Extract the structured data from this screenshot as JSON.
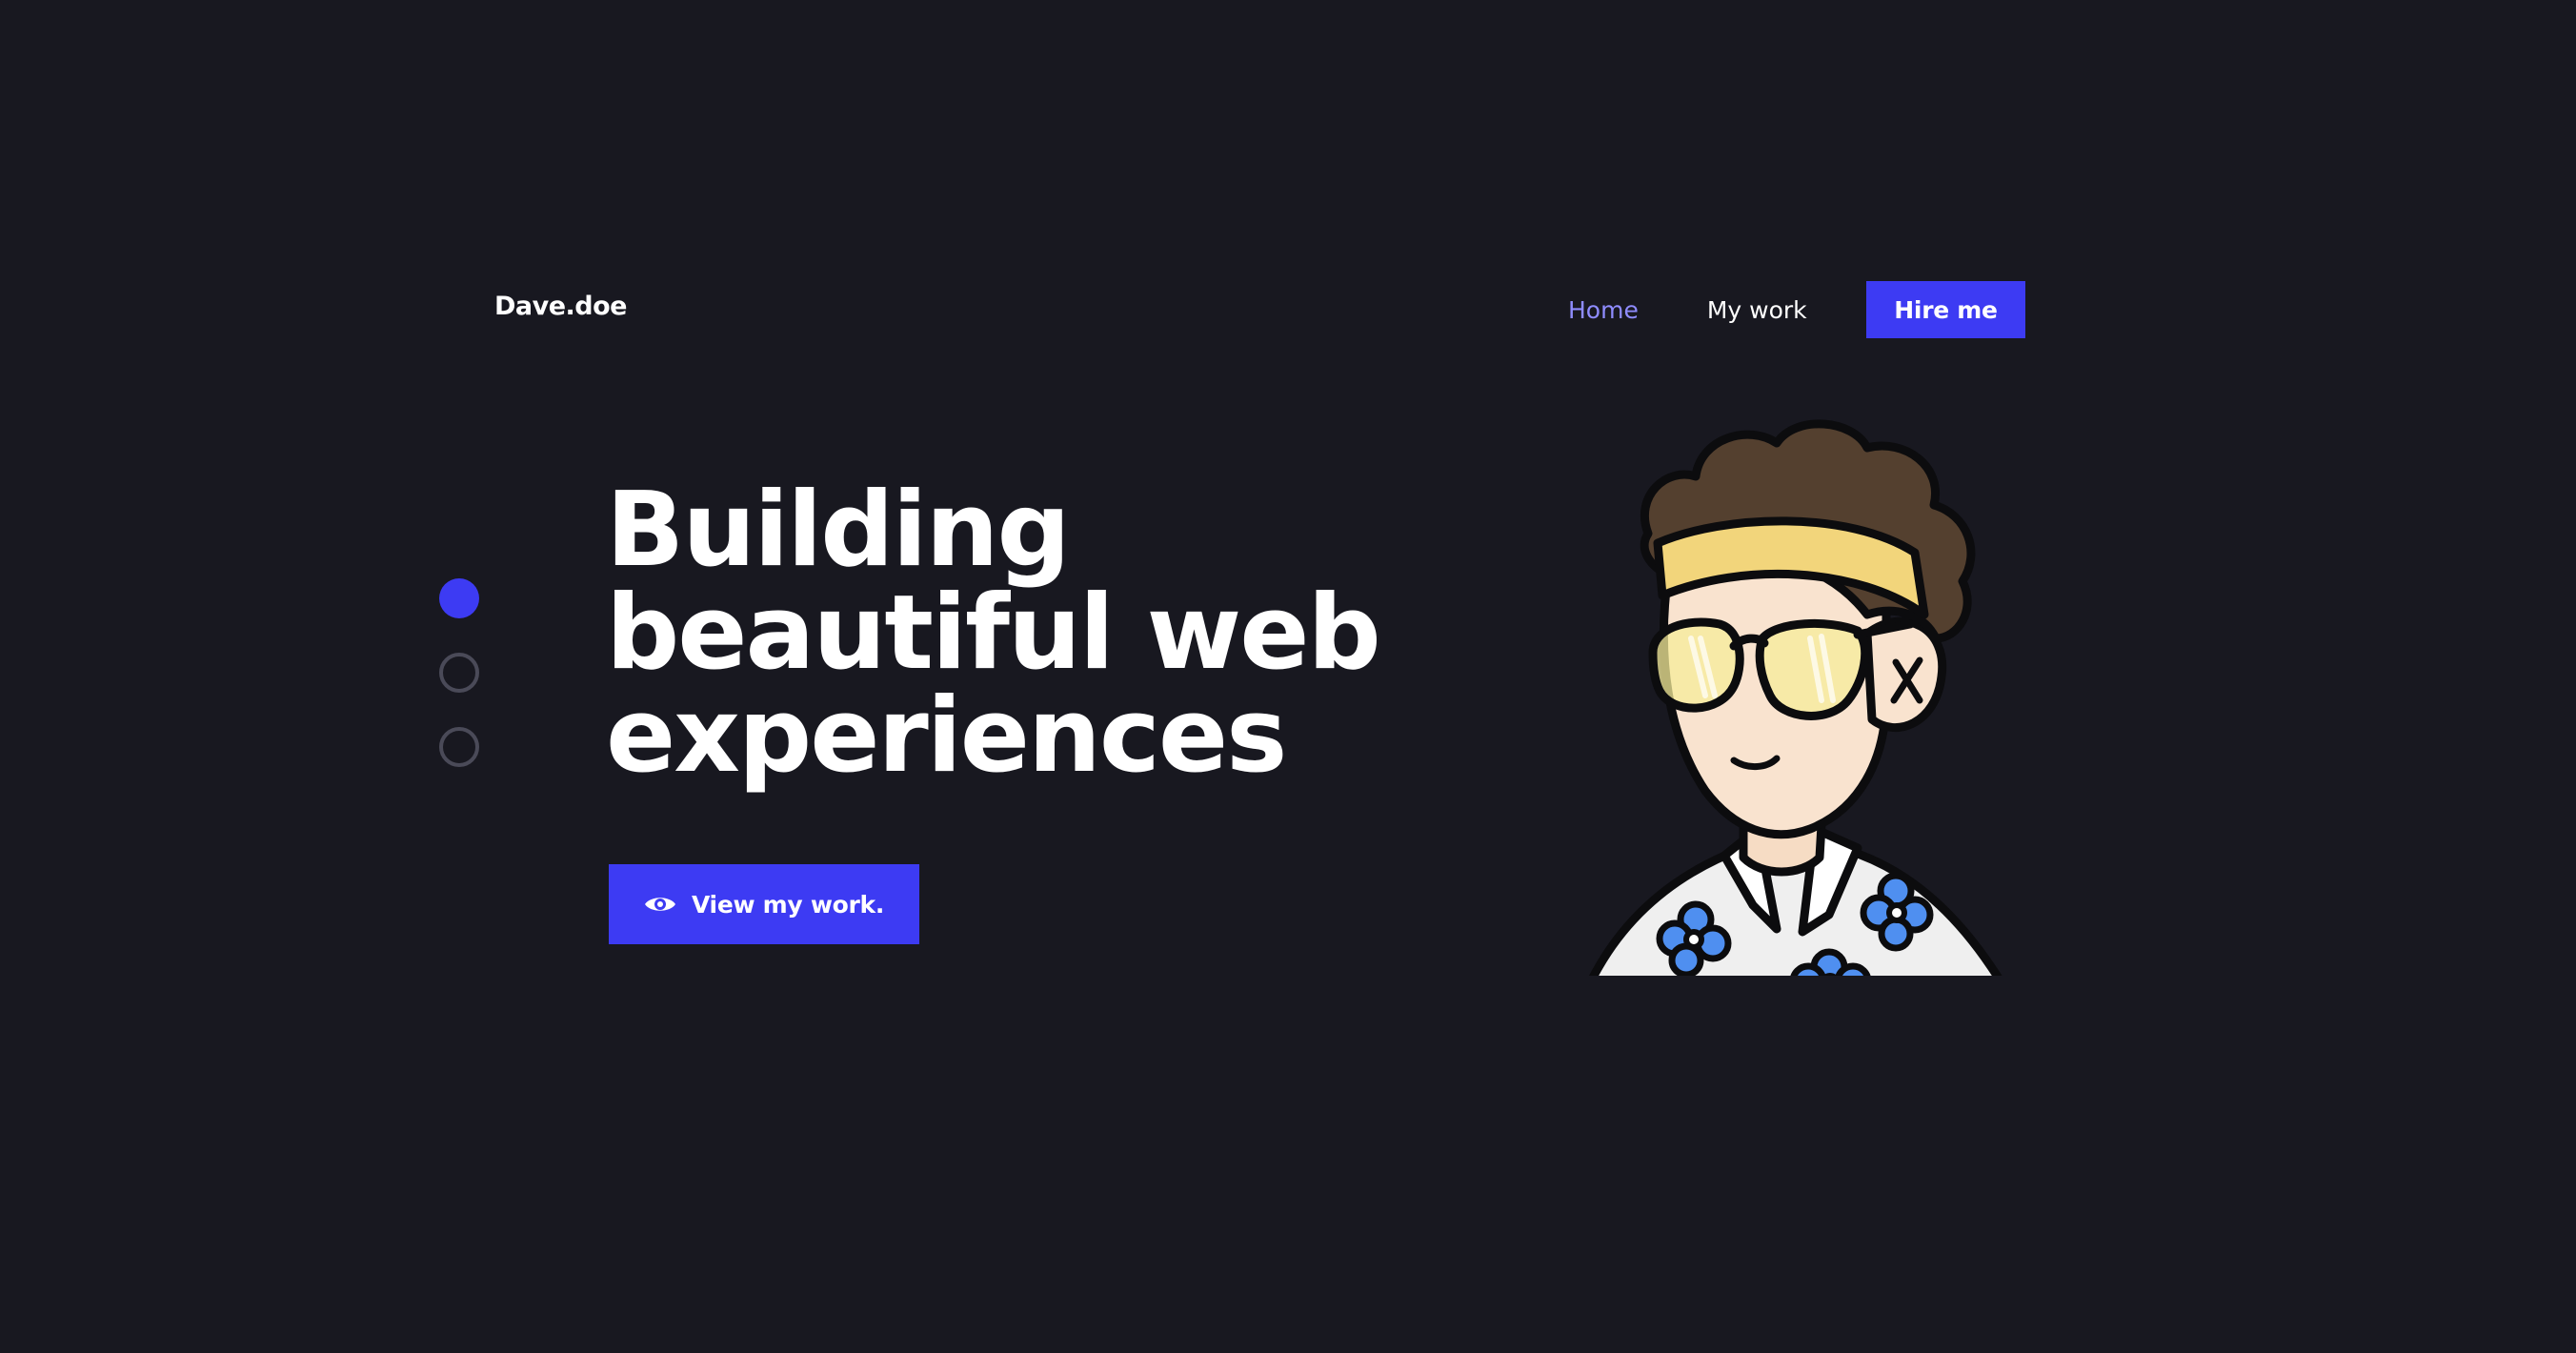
{
  "header": {
    "logo": "Dave.doe",
    "nav": [
      {
        "label": "Home",
        "active": true
      },
      {
        "label": "My work",
        "active": false
      }
    ],
    "hire_button": "Hire me"
  },
  "hero": {
    "title_lines": [
      "Building",
      "beautiful web",
      "experiences"
    ],
    "cta_label": "View my work.",
    "cta_icon": "eye-icon"
  },
  "slider": {
    "count": 3,
    "active_index": 0
  },
  "avatar": {
    "icon": "cartoon-avatar"
  },
  "colors": {
    "background": "#181820",
    "accent": "#3d3bf3",
    "active_link": "#8f8cff",
    "text": "#ffffff",
    "dot_inactive": "#4a4a58"
  }
}
